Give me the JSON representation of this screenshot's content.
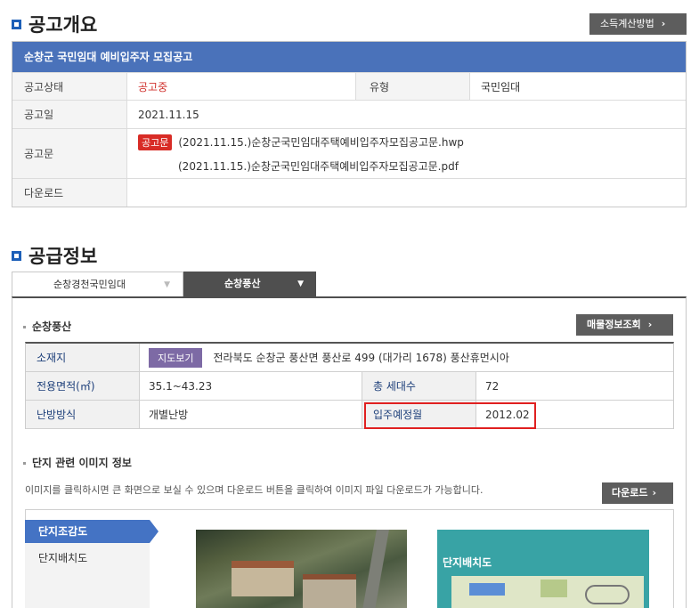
{
  "overview": {
    "title": "공고개요",
    "income_calc_button": "소득계산방법",
    "notice_title": "순창군 국민임대 예비입주자 모집공고",
    "status_label": "공고상태",
    "status_value": "공고중",
    "type_label": "유형",
    "type_value": "국민임대",
    "date_label": "공고일",
    "date_value": "2021.11.15",
    "doc_label": "공고문",
    "doc_badge": "공고문",
    "doc_files": [
      "(2021.11.15.)순창군국민임대주택예비입주자모집공고문.hwp",
      "(2021.11.15.)순창군국민임대주택예비입주자모집공고문.pdf"
    ],
    "download_label": "다운로드"
  },
  "supply": {
    "title": "공급정보",
    "tabs": [
      "순창경천국민임대",
      "순창풍산"
    ],
    "section_title": "순창풍산",
    "property_button": "매물정보조회",
    "address_label": "소재지",
    "map_button": "지도보기",
    "address_value": "전라북도 순창군 풍산면 풍산로 499 (대가리 1678) 풍산휴먼시아",
    "area_label": "전용면적(㎡)",
    "area_value": "35.1~43.23",
    "households_label": "총 세대수",
    "households_value": "72",
    "heating_label": "난방방식",
    "heating_value": "개별난방",
    "movein_label": "입주예정월",
    "movein_value": "2012.02"
  },
  "images": {
    "title": "단지 관련 이미지 정보",
    "description": "이미지를 클릭하시면 큰 화면으로 보실 수 있으며 다운로드 버튼을 클릭하여 이미지 파일 다운로드가 가능합니다.",
    "download_button": "다운로드",
    "side_items": [
      "단지조감도",
      "단지배치도"
    ],
    "layout_caption": "단지배치도"
  }
}
